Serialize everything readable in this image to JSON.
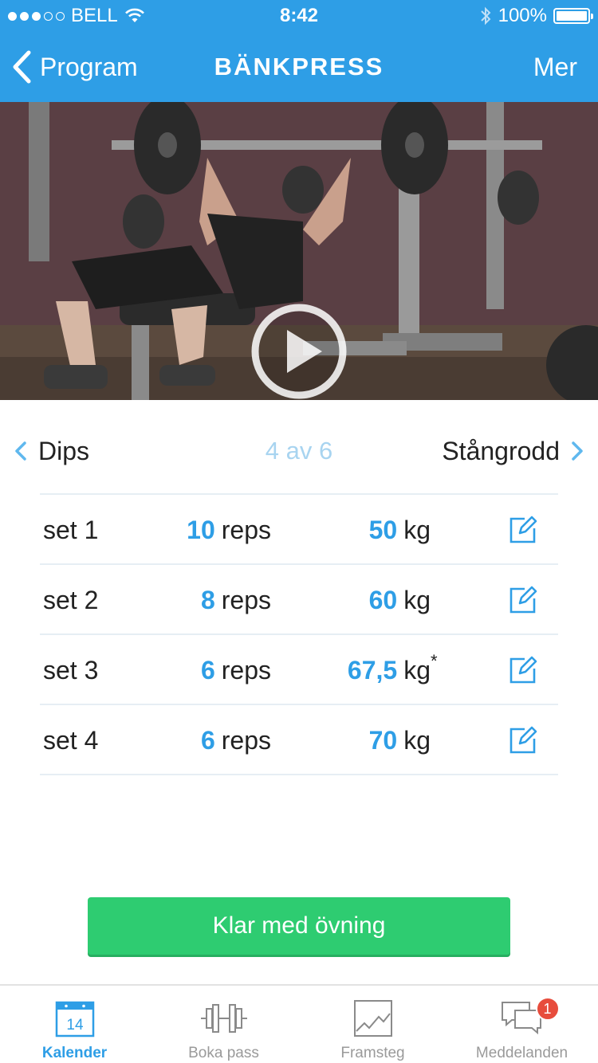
{
  "status_bar": {
    "carrier": "BELL",
    "time": "8:42",
    "battery": "100%"
  },
  "nav": {
    "back_label": "Program",
    "title": "BÄNKPRESS",
    "more_label": "Mer"
  },
  "hero": {
    "page_count": 3,
    "active_page": 1
  },
  "exercise_nav": {
    "prev": "Dips",
    "position": "4 av 6",
    "next": "Stångrodd"
  },
  "sets": [
    {
      "label": "set 1",
      "reps": "10",
      "reps_unit": "reps",
      "weight": "50",
      "weight_unit": "kg",
      "note": ""
    },
    {
      "label": "set 2",
      "reps": "8",
      "reps_unit": "reps",
      "weight": "60",
      "weight_unit": "kg",
      "note": ""
    },
    {
      "label": "set 3",
      "reps": "6",
      "reps_unit": "reps",
      "weight": "67,5",
      "weight_unit": "kg",
      "note": "*"
    },
    {
      "label": "set 4",
      "reps": "6",
      "reps_unit": "reps",
      "weight": "70",
      "weight_unit": "kg",
      "note": ""
    }
  ],
  "done_button": "Klar med övning",
  "tabs": [
    {
      "label": "Kalender",
      "icon": "calendar-icon",
      "icon_text": "14",
      "active": true
    },
    {
      "label": "Boka pass",
      "icon": "dumbbell-icon",
      "active": false
    },
    {
      "label": "Framsteg",
      "icon": "chart-icon",
      "active": false
    },
    {
      "label": "Meddelanden",
      "icon": "messages-icon",
      "badge": "1",
      "active": false
    }
  ],
  "colors": {
    "primary": "#2e9ee6",
    "success": "#2ecc71",
    "badge": "#e74c3c"
  }
}
